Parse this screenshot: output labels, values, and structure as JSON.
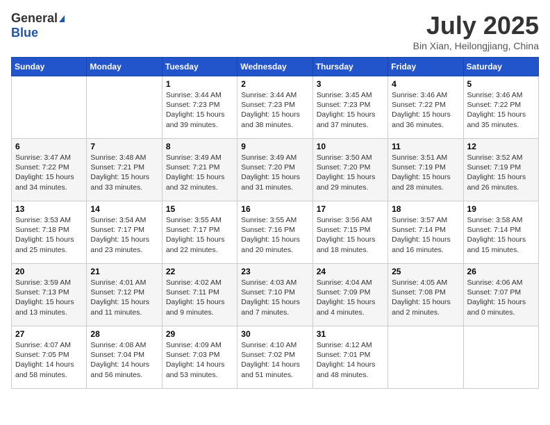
{
  "header": {
    "logo_general": "General",
    "logo_blue": "Blue",
    "month": "July 2025",
    "location": "Bin Xian, Heilongjiang, China"
  },
  "days_of_week": [
    "Sunday",
    "Monday",
    "Tuesday",
    "Wednesday",
    "Thursday",
    "Friday",
    "Saturday"
  ],
  "weeks": [
    [
      {
        "day": "",
        "text": ""
      },
      {
        "day": "",
        "text": ""
      },
      {
        "day": "1",
        "text": "Sunrise: 3:44 AM\nSunset: 7:23 PM\nDaylight: 15 hours and 39 minutes."
      },
      {
        "day": "2",
        "text": "Sunrise: 3:44 AM\nSunset: 7:23 PM\nDaylight: 15 hours and 38 minutes."
      },
      {
        "day": "3",
        "text": "Sunrise: 3:45 AM\nSunset: 7:23 PM\nDaylight: 15 hours and 37 minutes."
      },
      {
        "day": "4",
        "text": "Sunrise: 3:46 AM\nSunset: 7:22 PM\nDaylight: 15 hours and 36 minutes."
      },
      {
        "day": "5",
        "text": "Sunrise: 3:46 AM\nSunset: 7:22 PM\nDaylight: 15 hours and 35 minutes."
      }
    ],
    [
      {
        "day": "6",
        "text": "Sunrise: 3:47 AM\nSunset: 7:22 PM\nDaylight: 15 hours and 34 minutes."
      },
      {
        "day": "7",
        "text": "Sunrise: 3:48 AM\nSunset: 7:21 PM\nDaylight: 15 hours and 33 minutes."
      },
      {
        "day": "8",
        "text": "Sunrise: 3:49 AM\nSunset: 7:21 PM\nDaylight: 15 hours and 32 minutes."
      },
      {
        "day": "9",
        "text": "Sunrise: 3:49 AM\nSunset: 7:20 PM\nDaylight: 15 hours and 31 minutes."
      },
      {
        "day": "10",
        "text": "Sunrise: 3:50 AM\nSunset: 7:20 PM\nDaylight: 15 hours and 29 minutes."
      },
      {
        "day": "11",
        "text": "Sunrise: 3:51 AM\nSunset: 7:19 PM\nDaylight: 15 hours and 28 minutes."
      },
      {
        "day": "12",
        "text": "Sunrise: 3:52 AM\nSunset: 7:19 PM\nDaylight: 15 hours and 26 minutes."
      }
    ],
    [
      {
        "day": "13",
        "text": "Sunrise: 3:53 AM\nSunset: 7:18 PM\nDaylight: 15 hours and 25 minutes."
      },
      {
        "day": "14",
        "text": "Sunrise: 3:54 AM\nSunset: 7:17 PM\nDaylight: 15 hours and 23 minutes."
      },
      {
        "day": "15",
        "text": "Sunrise: 3:55 AM\nSunset: 7:17 PM\nDaylight: 15 hours and 22 minutes."
      },
      {
        "day": "16",
        "text": "Sunrise: 3:55 AM\nSunset: 7:16 PM\nDaylight: 15 hours and 20 minutes."
      },
      {
        "day": "17",
        "text": "Sunrise: 3:56 AM\nSunset: 7:15 PM\nDaylight: 15 hours and 18 minutes."
      },
      {
        "day": "18",
        "text": "Sunrise: 3:57 AM\nSunset: 7:14 PM\nDaylight: 15 hours and 16 minutes."
      },
      {
        "day": "19",
        "text": "Sunrise: 3:58 AM\nSunset: 7:14 PM\nDaylight: 15 hours and 15 minutes."
      }
    ],
    [
      {
        "day": "20",
        "text": "Sunrise: 3:59 AM\nSunset: 7:13 PM\nDaylight: 15 hours and 13 minutes."
      },
      {
        "day": "21",
        "text": "Sunrise: 4:01 AM\nSunset: 7:12 PM\nDaylight: 15 hours and 11 minutes."
      },
      {
        "day": "22",
        "text": "Sunrise: 4:02 AM\nSunset: 7:11 PM\nDaylight: 15 hours and 9 minutes."
      },
      {
        "day": "23",
        "text": "Sunrise: 4:03 AM\nSunset: 7:10 PM\nDaylight: 15 hours and 7 minutes."
      },
      {
        "day": "24",
        "text": "Sunrise: 4:04 AM\nSunset: 7:09 PM\nDaylight: 15 hours and 4 minutes."
      },
      {
        "day": "25",
        "text": "Sunrise: 4:05 AM\nSunset: 7:08 PM\nDaylight: 15 hours and 2 minutes."
      },
      {
        "day": "26",
        "text": "Sunrise: 4:06 AM\nSunset: 7:07 PM\nDaylight: 15 hours and 0 minutes."
      }
    ],
    [
      {
        "day": "27",
        "text": "Sunrise: 4:07 AM\nSunset: 7:05 PM\nDaylight: 14 hours and 58 minutes."
      },
      {
        "day": "28",
        "text": "Sunrise: 4:08 AM\nSunset: 7:04 PM\nDaylight: 14 hours and 56 minutes."
      },
      {
        "day": "29",
        "text": "Sunrise: 4:09 AM\nSunset: 7:03 PM\nDaylight: 14 hours and 53 minutes."
      },
      {
        "day": "30",
        "text": "Sunrise: 4:10 AM\nSunset: 7:02 PM\nDaylight: 14 hours and 51 minutes."
      },
      {
        "day": "31",
        "text": "Sunrise: 4:12 AM\nSunset: 7:01 PM\nDaylight: 14 hours and 48 minutes."
      },
      {
        "day": "",
        "text": ""
      },
      {
        "day": "",
        "text": ""
      }
    ]
  ]
}
